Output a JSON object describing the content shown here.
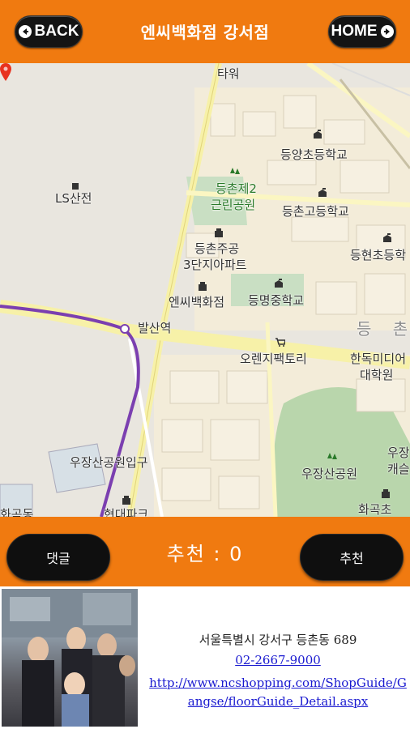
{
  "header": {
    "back_label": "BACK",
    "home_label": "HOME",
    "title": "엔씨백화점 강서점",
    "bg_color": "#f07a10"
  },
  "map": {
    "labels": {
      "tower": "타워",
      "ls": "LS산전",
      "deungyang": "등양초등학교",
      "park2": "등촌제2",
      "park2b": "근린공원",
      "deungchon_high": "등촌고등학교",
      "deunghyeon": "등현초등학",
      "apt1": "등촌주공",
      "apt2": "3단지아파트",
      "ncdept": "엔씨백화점",
      "deungmyeong": "등명중학교",
      "balsan": "발산역",
      "orange": "오렌지팩토리",
      "media1": "한독미디어",
      "media2": "대학원",
      "deungchon_area": "등 촌",
      "ujang_entrance": "우장산공원입구",
      "ujang_park": "우장산공원",
      "ujang_right1": "우장",
      "ujang_right2": "캐슬",
      "hyundai": "현대파크",
      "hwagok": "화곡초",
      "bottom_left": "화곡동"
    },
    "icons": [
      "building-icon",
      "school-icon",
      "park-icon",
      "shop-icon",
      "location-marker-icon"
    ]
  },
  "action_bar": {
    "comment_label": "댓글",
    "recommend_text": "추천 : 0",
    "recommend_button_label": "추천"
  },
  "info": {
    "address": "서울특별시 강서구 등촌동 689",
    "phone": "02-2667-9000",
    "url": "http://www.ncshopping.com/ShopGuide/Gangse/floorGuide_Detail.aspx"
  }
}
